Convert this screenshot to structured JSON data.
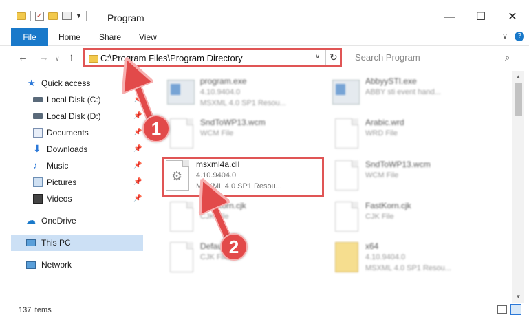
{
  "window": {
    "title": "Program",
    "minimize_glyph": "—",
    "maximize_glyph": "☐",
    "close_glyph": "✕"
  },
  "ribbon": {
    "tabs": [
      "File",
      "Home",
      "Share",
      "View"
    ],
    "expand_glyph": "∨",
    "help_glyph": "?"
  },
  "nav": {
    "back_glyph": "←",
    "forward_glyph": "→",
    "recent_glyph": "∨",
    "up_glyph": "↑"
  },
  "address": {
    "path": "C:\\Program Files\\Program Directory",
    "dropdown_glyph": "∨",
    "refresh_glyph": "↻"
  },
  "search": {
    "placeholder": "Search Program",
    "icon_glyph": "⌕"
  },
  "sidebar": {
    "pin_glyph": "📌",
    "items": [
      {
        "label": "Quick access",
        "icon": "star-icon"
      },
      {
        "label": "Local Disk (C:)",
        "icon": "disk-icon",
        "pinned": true
      },
      {
        "label": "Local Disk (D:)",
        "icon": "disk-icon",
        "pinned": true
      },
      {
        "label": "Documents",
        "icon": "documents-icon",
        "pinned": true
      },
      {
        "label": "Downloads",
        "icon": "download-icon",
        "pinned": true
      },
      {
        "label": "Music",
        "icon": "music-icon",
        "pinned": true
      },
      {
        "label": "Pictures",
        "icon": "pictures-icon",
        "pinned": true
      },
      {
        "label": "Videos",
        "icon": "videos-icon",
        "pinned": true
      },
      {
        "label": "OneDrive",
        "icon": "cloud-icon"
      },
      {
        "label": "This PC",
        "icon": "computer-icon",
        "selected": true
      },
      {
        "label": "Network",
        "icon": "network-icon"
      }
    ]
  },
  "files": {
    "program_exe": {
      "name": "program.exe",
      "line1": "4.10.9404.0",
      "line2": "MSXML 4.0 SP1 Resou..."
    },
    "abbyy_exe": {
      "name": "AbbyySTI.exe",
      "line1": "ABBY sti event hand..."
    },
    "sndtowp13_left": {
      "name": "SndToWP13.wcm",
      "line1": "WCM File"
    },
    "arabic_wrd": {
      "name": "Arabic.wrd",
      "line1": "WRD File"
    },
    "msxml4a_dll": {
      "name": "msxml4a.dll",
      "line1": "4.10.9404.0",
      "line2": "MSXML 4.0 SP1 Resou..."
    },
    "sndtowp13_right": {
      "name": "SndToWP13.wcm",
      "line1": "WCM File"
    },
    "fastkorn_left": {
      "name": "FastKorn.cjk",
      "line1": "CJK File"
    },
    "fastkorn_right": {
      "name": "FastKorn.cjk",
      "line1": "CJK File"
    },
    "default_cjk": {
      "name": "Default.cjk",
      "line1": "CJK File"
    },
    "x64": {
      "name": "x64",
      "line1": "4.10.9404.0",
      "line2": "MSXML 4.0 SP1 Resou..."
    }
  },
  "status": {
    "count": "137 items"
  },
  "annotations": {
    "step1": "1",
    "step2": "2",
    "color": "#e24a4a"
  }
}
